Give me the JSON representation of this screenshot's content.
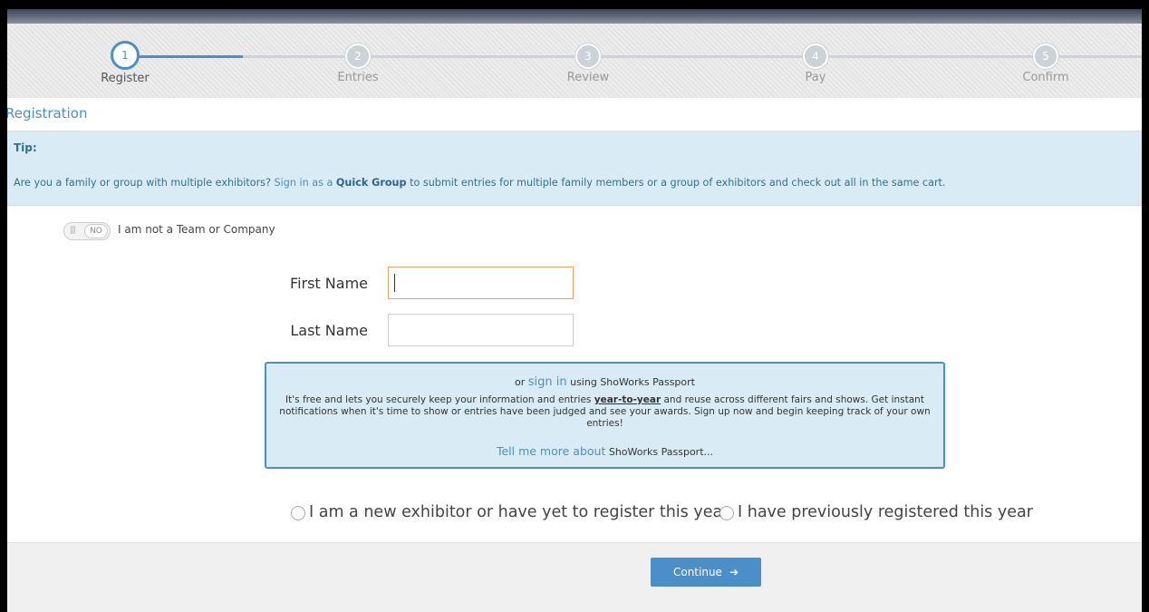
{
  "steps": [
    {
      "num": "1",
      "label": "Register",
      "active": true
    },
    {
      "num": "2",
      "label": "Entries",
      "active": false
    },
    {
      "num": "3",
      "label": "Review",
      "active": false
    },
    {
      "num": "4",
      "label": "Pay",
      "active": false
    },
    {
      "num": "5",
      "label": "Confirm",
      "active": false
    }
  ],
  "page_title": "Registration",
  "tip": {
    "title": "Tip:",
    "prefix": "Are you a family or group with multiple exhibitors? ",
    "sign_in_link": "Sign in as a ",
    "quick_group": "Quick Group",
    "suffix": " to submit entries for multiple family members or a group of exhibitors and check out all in the same cart."
  },
  "team_toggle": {
    "state": "NO",
    "label": "I am not a Team or Company"
  },
  "fields": {
    "first_name_label": "First Name",
    "first_name_value": "",
    "last_name_label": "Last Name",
    "last_name_value": ""
  },
  "passport": {
    "or": "or ",
    "sign_in": "sign in",
    "using": " using ShoWorks Passport",
    "body_1": "It's free and lets you securely keep your information and entries ",
    "year_to_year": "year-to-year",
    "body_2": " and reuse across different fairs and shows. Get instant notifications when it's time to show or entries have been judged and see your awards. Sign up now and begin keeping track of your own entries!",
    "tell_more": "Tell me more about",
    "tell_more_suffix": " ShoWorks Passport..."
  },
  "radios": {
    "new_exhibitor": "I am a new exhibitor or have yet to register this year",
    "previous": "I have previously registered this year"
  },
  "continue_label": "Continue",
  "colors": {
    "accent": "#4a8fc9",
    "tip_bg": "#d9ecf5"
  }
}
